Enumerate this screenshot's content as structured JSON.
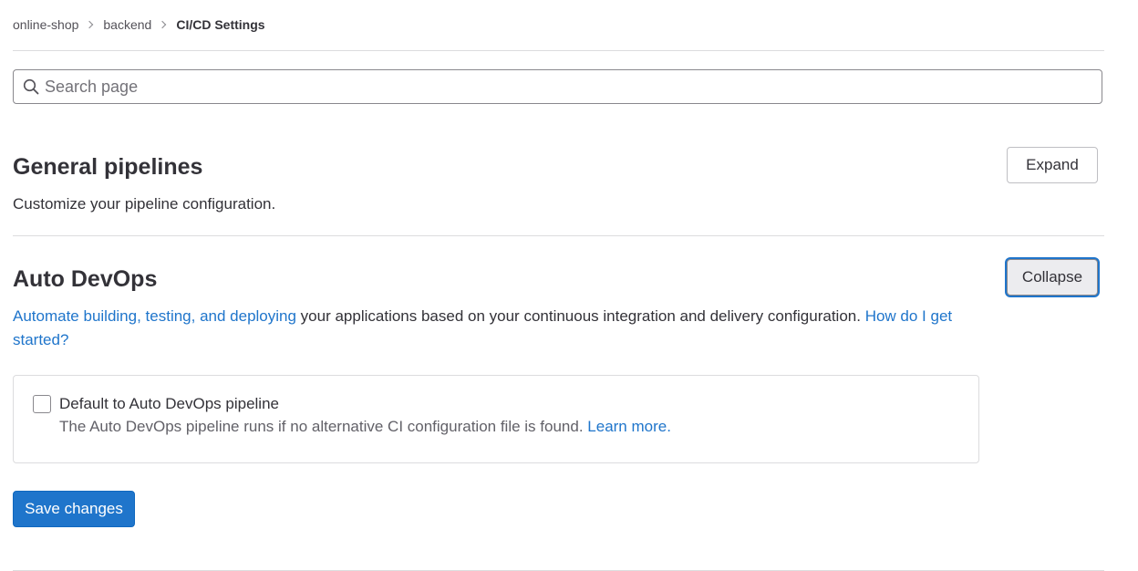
{
  "breadcrumb": {
    "items": [
      "online-shop",
      "backend",
      "CI/CD Settings"
    ]
  },
  "search": {
    "placeholder": "Search page",
    "value": ""
  },
  "sections": {
    "general_pipelines": {
      "title": "General pipelines",
      "description": "Customize your pipeline configuration.",
      "toggle_label": "Expand"
    },
    "auto_devops": {
      "title": "Auto DevOps",
      "toggle_label": "Collapse",
      "desc_link": "Automate building, testing, and deploying",
      "desc_text": " your applications based on your continuous integration and delivery configuration. ",
      "desc_help_link": "How do I get started?",
      "checkbox": {
        "label": "Default to Auto DevOps pipeline",
        "checked": false,
        "help_text": "The Auto DevOps pipeline runs if no alternative CI configuration file is found. ",
        "help_link": "Learn more."
      },
      "save_label": "Save changes"
    }
  },
  "colors": {
    "link": "#1f75cb",
    "primary": "#1f75cb",
    "border": "#dcdcde"
  },
  "icons": {
    "search": "search-icon",
    "breadcrumb_separator": "chevron-right-icon"
  }
}
